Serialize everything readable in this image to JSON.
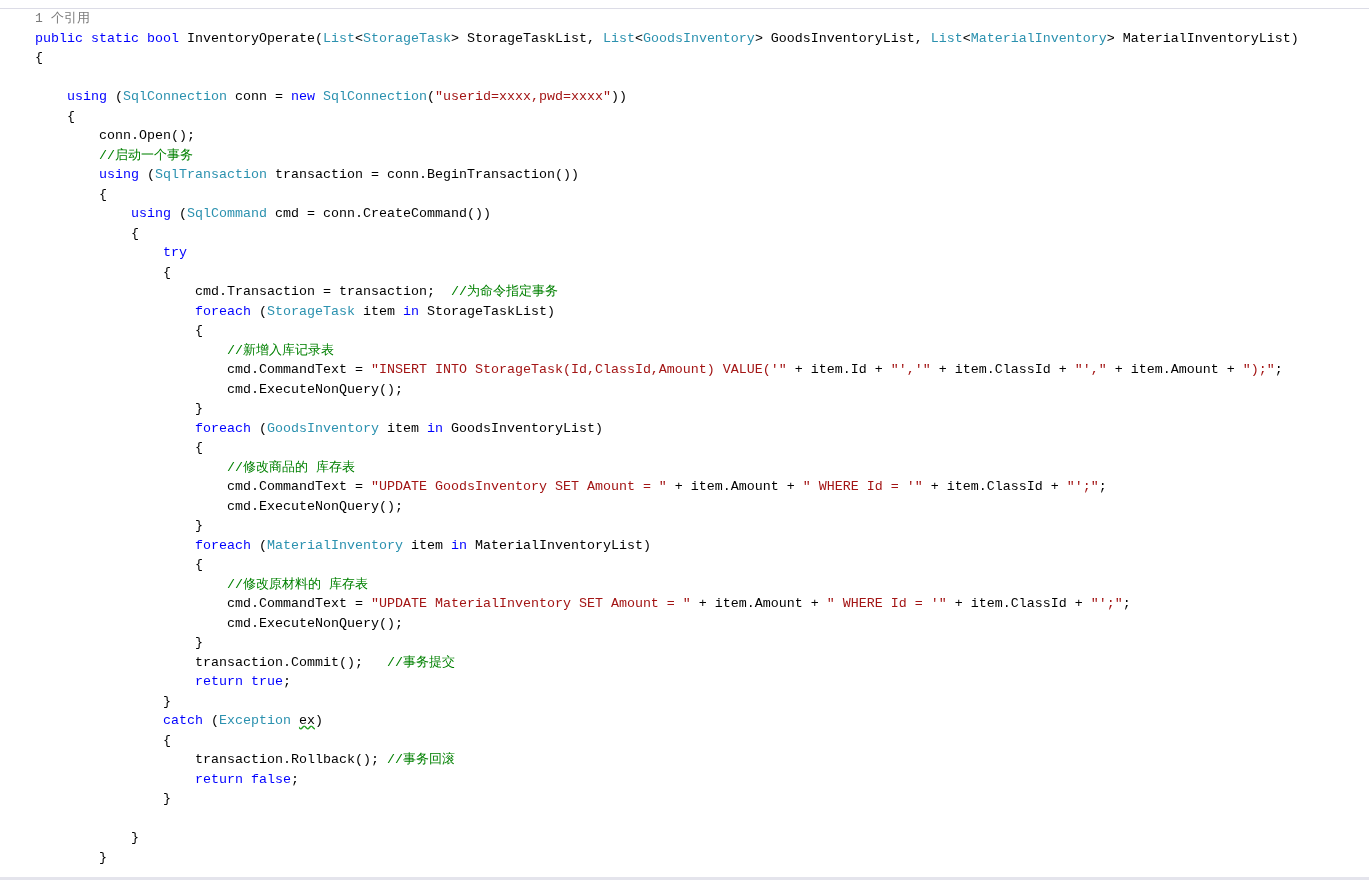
{
  "lines": [
    {
      "kind": "codelens",
      "text": "1 个引用"
    },
    {
      "kind": "code",
      "tokens": [
        {
          "kind": "keyword",
          "text": "public static bool"
        },
        {
          "kind": "plain",
          "text": " InventoryOperate("
        },
        {
          "kind": "type",
          "text": "List"
        },
        {
          "kind": "plain",
          "text": "<"
        },
        {
          "kind": "type",
          "text": "StorageTask"
        },
        {
          "kind": "plain",
          "text": "> StorageTaskList, "
        },
        {
          "kind": "type",
          "text": "List"
        },
        {
          "kind": "plain",
          "text": "<"
        },
        {
          "kind": "type",
          "text": "GoodsInventory"
        },
        {
          "kind": "plain",
          "text": "> GoodsInventoryList, "
        },
        {
          "kind": "type",
          "text": "List"
        },
        {
          "kind": "plain",
          "text": "<"
        },
        {
          "kind": "type",
          "text": "MaterialInventory"
        },
        {
          "kind": "plain",
          "text": "> MaterialInventoryList)"
        }
      ]
    },
    {
      "kind": "code",
      "tokens": [
        {
          "kind": "plain",
          "text": "{"
        }
      ]
    },
    {
      "kind": "blank"
    },
    {
      "kind": "code",
      "tokens": [
        {
          "kind": "keyword",
          "text": "    using"
        },
        {
          "kind": "plain",
          "text": " ("
        },
        {
          "kind": "type",
          "text": "SqlConnection"
        },
        {
          "kind": "plain",
          "text": " conn = "
        },
        {
          "kind": "keyword",
          "text": "new "
        },
        {
          "kind": "type",
          "text": "SqlConnection"
        },
        {
          "kind": "plain",
          "text": "("
        },
        {
          "kind": "string",
          "text": "\"userid=xxxx,pwd=xxxx\""
        },
        {
          "kind": "plain",
          "text": "))"
        }
      ]
    },
    {
      "kind": "code",
      "tokens": [
        {
          "kind": "plain",
          "text": "    {"
        }
      ]
    },
    {
      "kind": "code",
      "tokens": [
        {
          "kind": "plain",
          "text": "        conn.Open();"
        }
      ]
    },
    {
      "kind": "code",
      "tokens": [
        {
          "kind": "comment",
          "text": "        //启动一个事务"
        }
      ]
    },
    {
      "kind": "code",
      "tokens": [
        {
          "kind": "keyword",
          "text": "        using"
        },
        {
          "kind": "plain",
          "text": " ("
        },
        {
          "kind": "type",
          "text": "SqlTransaction"
        },
        {
          "kind": "plain",
          "text": " transaction = conn.BeginTransaction())"
        }
      ]
    },
    {
      "kind": "code",
      "tokens": [
        {
          "kind": "plain",
          "text": "        {"
        }
      ]
    },
    {
      "kind": "code",
      "tokens": [
        {
          "kind": "keyword",
          "text": "            using"
        },
        {
          "kind": "plain",
          "text": " ("
        },
        {
          "kind": "type",
          "text": "SqlCommand"
        },
        {
          "kind": "plain",
          "text": " cmd = conn.CreateCommand())"
        }
      ]
    },
    {
      "kind": "code",
      "tokens": [
        {
          "kind": "plain",
          "text": "            {"
        }
      ]
    },
    {
      "kind": "code",
      "tokens": [
        {
          "kind": "keyword",
          "text": "                try"
        }
      ]
    },
    {
      "kind": "code",
      "tokens": [
        {
          "kind": "plain",
          "text": "                {"
        }
      ]
    },
    {
      "kind": "code",
      "tokens": [
        {
          "kind": "plain",
          "text": "                    cmd.Transaction = transaction;  "
        },
        {
          "kind": "comment",
          "text": "//为命令指定事务"
        }
      ]
    },
    {
      "kind": "code",
      "tokens": [
        {
          "kind": "keyword",
          "text": "                    foreach"
        },
        {
          "kind": "plain",
          "text": " ("
        },
        {
          "kind": "type",
          "text": "StorageTask"
        },
        {
          "kind": "plain",
          "text": " item "
        },
        {
          "kind": "keyword",
          "text": "in"
        },
        {
          "kind": "plain",
          "text": " StorageTaskList)"
        }
      ]
    },
    {
      "kind": "code",
      "tokens": [
        {
          "kind": "plain",
          "text": "                    {"
        }
      ]
    },
    {
      "kind": "code",
      "tokens": [
        {
          "kind": "comment",
          "text": "                        //新增入库记录表"
        }
      ]
    },
    {
      "kind": "code",
      "tokens": [
        {
          "kind": "plain",
          "text": "                        cmd.CommandText = "
        },
        {
          "kind": "string",
          "text": "\"INSERT INTO StorageTask(Id,ClassId,Amount) VALUE('\""
        },
        {
          "kind": "plain",
          "text": " + item.Id + "
        },
        {
          "kind": "string",
          "text": "\"','\""
        },
        {
          "kind": "plain",
          "text": " + item.ClassId + "
        },
        {
          "kind": "string",
          "text": "\"',\""
        },
        {
          "kind": "plain",
          "text": " + item.Amount + "
        },
        {
          "kind": "string",
          "text": "\");\""
        },
        {
          "kind": "plain",
          "text": ";"
        }
      ]
    },
    {
      "kind": "code",
      "tokens": [
        {
          "kind": "plain",
          "text": "                        cmd.ExecuteNonQuery();"
        }
      ]
    },
    {
      "kind": "code",
      "tokens": [
        {
          "kind": "plain",
          "text": "                    }"
        }
      ]
    },
    {
      "kind": "code",
      "tokens": [
        {
          "kind": "keyword",
          "text": "                    foreach"
        },
        {
          "kind": "plain",
          "text": " ("
        },
        {
          "kind": "type",
          "text": "GoodsInventory"
        },
        {
          "kind": "plain",
          "text": " item "
        },
        {
          "kind": "keyword",
          "text": "in"
        },
        {
          "kind": "plain",
          "text": " GoodsInventoryList)"
        }
      ]
    },
    {
      "kind": "code",
      "tokens": [
        {
          "kind": "plain",
          "text": "                    {"
        }
      ]
    },
    {
      "kind": "code",
      "tokens": [
        {
          "kind": "comment",
          "text": "                        //修改商品的 库存表"
        }
      ]
    },
    {
      "kind": "code",
      "tokens": [
        {
          "kind": "plain",
          "text": "                        cmd.CommandText = "
        },
        {
          "kind": "string",
          "text": "\"UPDATE GoodsInventory SET Amount = \""
        },
        {
          "kind": "plain",
          "text": " + item.Amount + "
        },
        {
          "kind": "string",
          "text": "\" WHERE Id = '\""
        },
        {
          "kind": "plain",
          "text": " + item.ClassId + "
        },
        {
          "kind": "string",
          "text": "\"';\""
        },
        {
          "kind": "plain",
          "text": ";"
        }
      ]
    },
    {
      "kind": "code",
      "tokens": [
        {
          "kind": "plain",
          "text": "                        cmd.ExecuteNonQuery();"
        }
      ]
    },
    {
      "kind": "code",
      "tokens": [
        {
          "kind": "plain",
          "text": "                    }"
        }
      ]
    },
    {
      "kind": "code",
      "tokens": [
        {
          "kind": "keyword",
          "text": "                    foreach"
        },
        {
          "kind": "plain",
          "text": " ("
        },
        {
          "kind": "type",
          "text": "MaterialInventory"
        },
        {
          "kind": "plain",
          "text": " item "
        },
        {
          "kind": "keyword",
          "text": "in"
        },
        {
          "kind": "plain",
          "text": " MaterialInventoryList)"
        }
      ]
    },
    {
      "kind": "code",
      "tokens": [
        {
          "kind": "plain",
          "text": "                    {"
        }
      ]
    },
    {
      "kind": "code",
      "tokens": [
        {
          "kind": "comment",
          "text": "                        //修改原材料的 库存表"
        }
      ]
    },
    {
      "kind": "code",
      "tokens": [
        {
          "kind": "plain",
          "text": "                        cmd.CommandText = "
        },
        {
          "kind": "string",
          "text": "\"UPDATE MaterialInventory SET Amount = \""
        },
        {
          "kind": "plain",
          "text": " + item.Amount + "
        },
        {
          "kind": "string",
          "text": "\" WHERE Id = '\""
        },
        {
          "kind": "plain",
          "text": " + item.ClassId + "
        },
        {
          "kind": "string",
          "text": "\"';\""
        },
        {
          "kind": "plain",
          "text": ";"
        }
      ]
    },
    {
      "kind": "code",
      "tokens": [
        {
          "kind": "plain",
          "text": "                        cmd.ExecuteNonQuery();"
        }
      ]
    },
    {
      "kind": "code",
      "tokens": [
        {
          "kind": "plain",
          "text": "                    }"
        }
      ]
    },
    {
      "kind": "code",
      "tokens": [
        {
          "kind": "plain",
          "text": "                    transaction.Commit();   "
        },
        {
          "kind": "comment",
          "text": "//事务提交"
        }
      ]
    },
    {
      "kind": "code",
      "tokens": [
        {
          "kind": "keyword",
          "text": "                    return true"
        },
        {
          "kind": "plain",
          "text": ";"
        }
      ]
    },
    {
      "kind": "code",
      "tokens": [
        {
          "kind": "plain",
          "text": "                }"
        }
      ]
    },
    {
      "kind": "code",
      "tokens": [
        {
          "kind": "keyword",
          "text": "                catch"
        },
        {
          "kind": "plain",
          "text": " ("
        },
        {
          "kind": "type",
          "text": "Exception "
        },
        {
          "kind": "warning",
          "text": "ex"
        },
        {
          "kind": "plain",
          "text": ")"
        }
      ]
    },
    {
      "kind": "code",
      "tokens": [
        {
          "kind": "plain",
          "text": "                {"
        }
      ]
    },
    {
      "kind": "code",
      "tokens": [
        {
          "kind": "plain",
          "text": "                    transaction.Rollback(); "
        },
        {
          "kind": "comment",
          "text": "//事务回滚"
        }
      ]
    },
    {
      "kind": "code",
      "tokens": [
        {
          "kind": "keyword",
          "text": "                    return false"
        },
        {
          "kind": "plain",
          "text": ";"
        }
      ]
    },
    {
      "kind": "code",
      "tokens": [
        {
          "kind": "plain",
          "text": "                }"
        }
      ]
    },
    {
      "kind": "blank"
    },
    {
      "kind": "code",
      "tokens": [
        {
          "kind": "plain",
          "text": "            }"
        }
      ]
    },
    {
      "kind": "code",
      "tokens": [
        {
          "kind": "plain",
          "text": "        }"
        }
      ]
    }
  ]
}
